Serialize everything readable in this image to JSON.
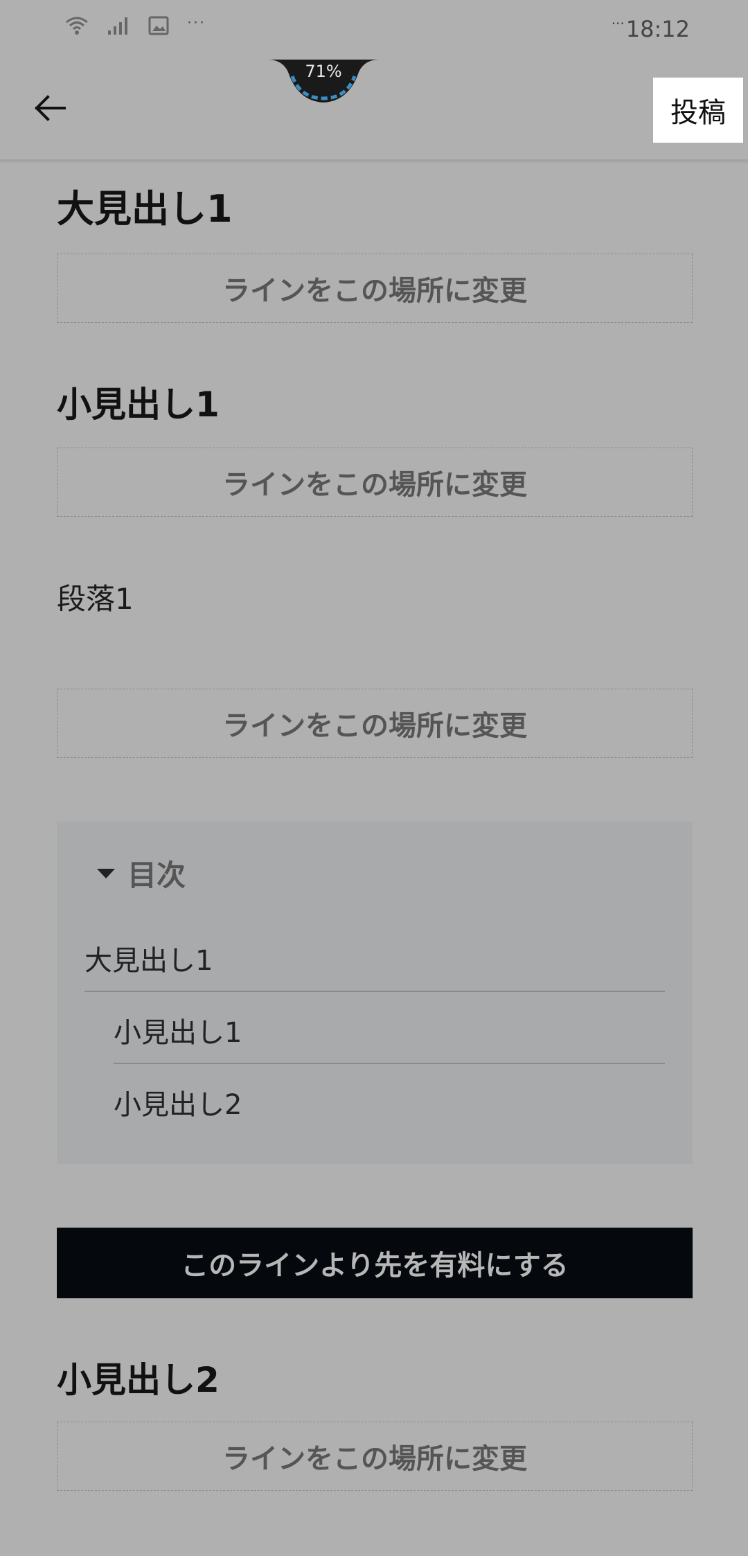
{
  "status_bar": {
    "time": "18:12",
    "overflow_left": "···",
    "overflow_right": "···",
    "icons": [
      "wifi-icon",
      "signal-icon",
      "image-icon"
    ]
  },
  "battery_overlay": {
    "text": "71%",
    "ring_color": "#3a8ec8"
  },
  "app_bar": {
    "back_icon": "arrow-left-icon",
    "post_label": "投稿"
  },
  "editor": {
    "heading_large_1": "大見出し1",
    "heading_small_1": "小見出し1",
    "paragraph_1": "段落1",
    "heading_small_2": "小見出し2",
    "line_change_label": "ラインをこの場所に変更",
    "paid_line_label": "このラインより先を有料にする"
  },
  "toc": {
    "title": "目次",
    "items": [
      {
        "label": "大見出し1"
      },
      {
        "label": "小見出し1"
      },
      {
        "label": "小見出し2"
      }
    ]
  },
  "colors": {
    "background": "#b0b0b0",
    "toc_background": "#a9aaac",
    "paid_line_background": "#05090d",
    "post_button_background": "#ffffff"
  }
}
